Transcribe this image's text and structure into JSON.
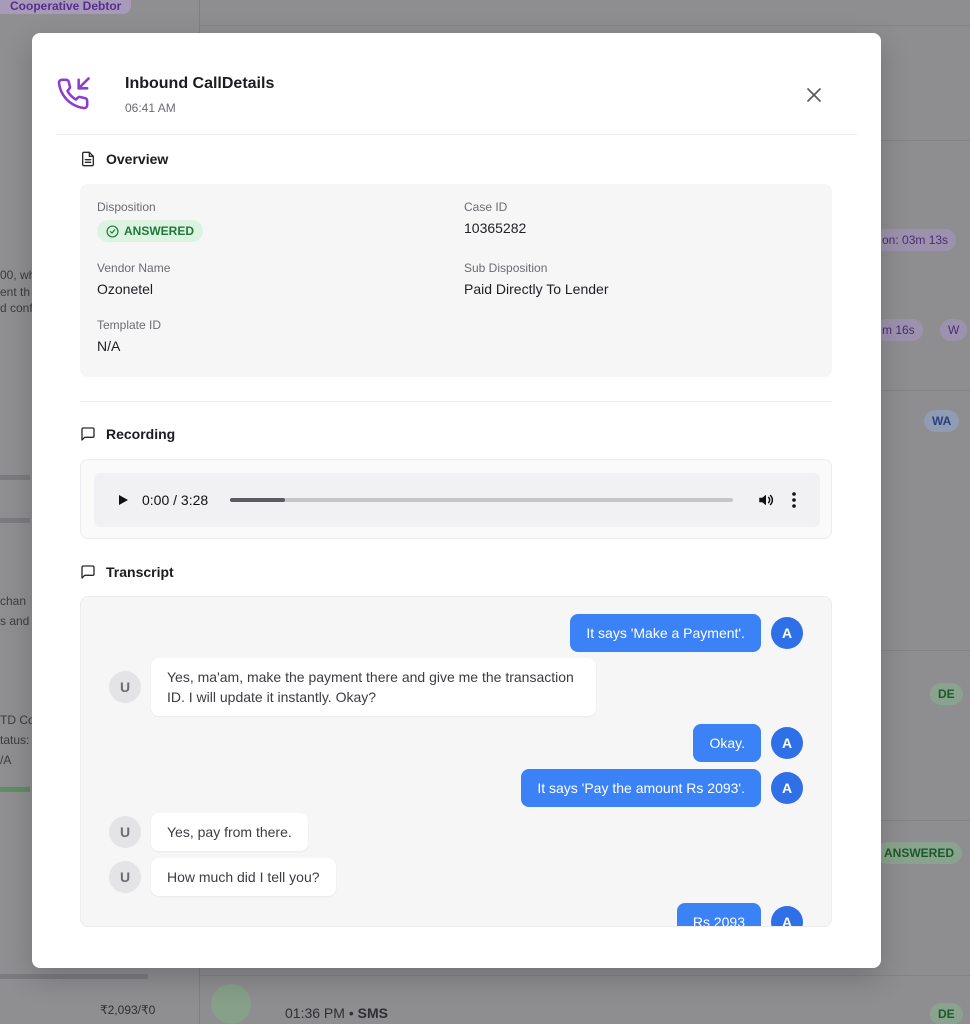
{
  "background": {
    "tag_label": "Cooperative Debtor",
    "left_fragments": [
      "00, wh",
      "ent th",
      "d conf",
      "chan",
      "s and",
      "TD Co",
      "tatus:",
      "/A"
    ],
    "right_pills": [
      "on: 03m 13s",
      "m 16s",
      "W",
      "WA",
      "DE",
      "ANSWERED",
      "DE"
    ],
    "amount": "₹2,093/₹0",
    "footer_time": "01:36 PM",
    "footer_channel": "SMS"
  },
  "modal": {
    "title": "Inbound CallDetails",
    "time": "06:41 AM",
    "close_label": "×"
  },
  "overview": {
    "heading": "Overview",
    "disposition_label": "Disposition",
    "disposition_value": "ANSWERED",
    "case_id_label": "Case ID",
    "case_id_value": "10365282",
    "vendor_label": "Vendor Name",
    "vendor_value": "Ozonetel",
    "sub_disposition_label": "Sub Disposition",
    "sub_disposition_value": "Paid Directly To Lender",
    "template_label": "Template ID",
    "template_value": "N/A"
  },
  "recording": {
    "heading": "Recording",
    "time_display": "0:00 / 3:28",
    "progress_fraction": 0.11
  },
  "transcript": {
    "heading": "Transcript",
    "messages": [
      {
        "speaker": "A",
        "text": "It says 'Make a Payment'."
      },
      {
        "speaker": "U",
        "text": "Yes, ma'am, make the payment there and give me the transaction ID. I will update it instantly. Okay?"
      },
      {
        "speaker": "A",
        "text": "Okay."
      },
      {
        "speaker": "A",
        "text": "It says 'Pay the amount Rs 2093'."
      },
      {
        "speaker": "U",
        "text": "Yes, pay from there."
      },
      {
        "speaker": "U",
        "text": "How much did I tell you?"
      },
      {
        "speaker": "A",
        "text": "Rs 2093"
      }
    ]
  },
  "colors": {
    "accent_purple": "#8b3dd1",
    "agent_bubble": "#3b82f6",
    "answered_green": "#1f7a3a"
  }
}
